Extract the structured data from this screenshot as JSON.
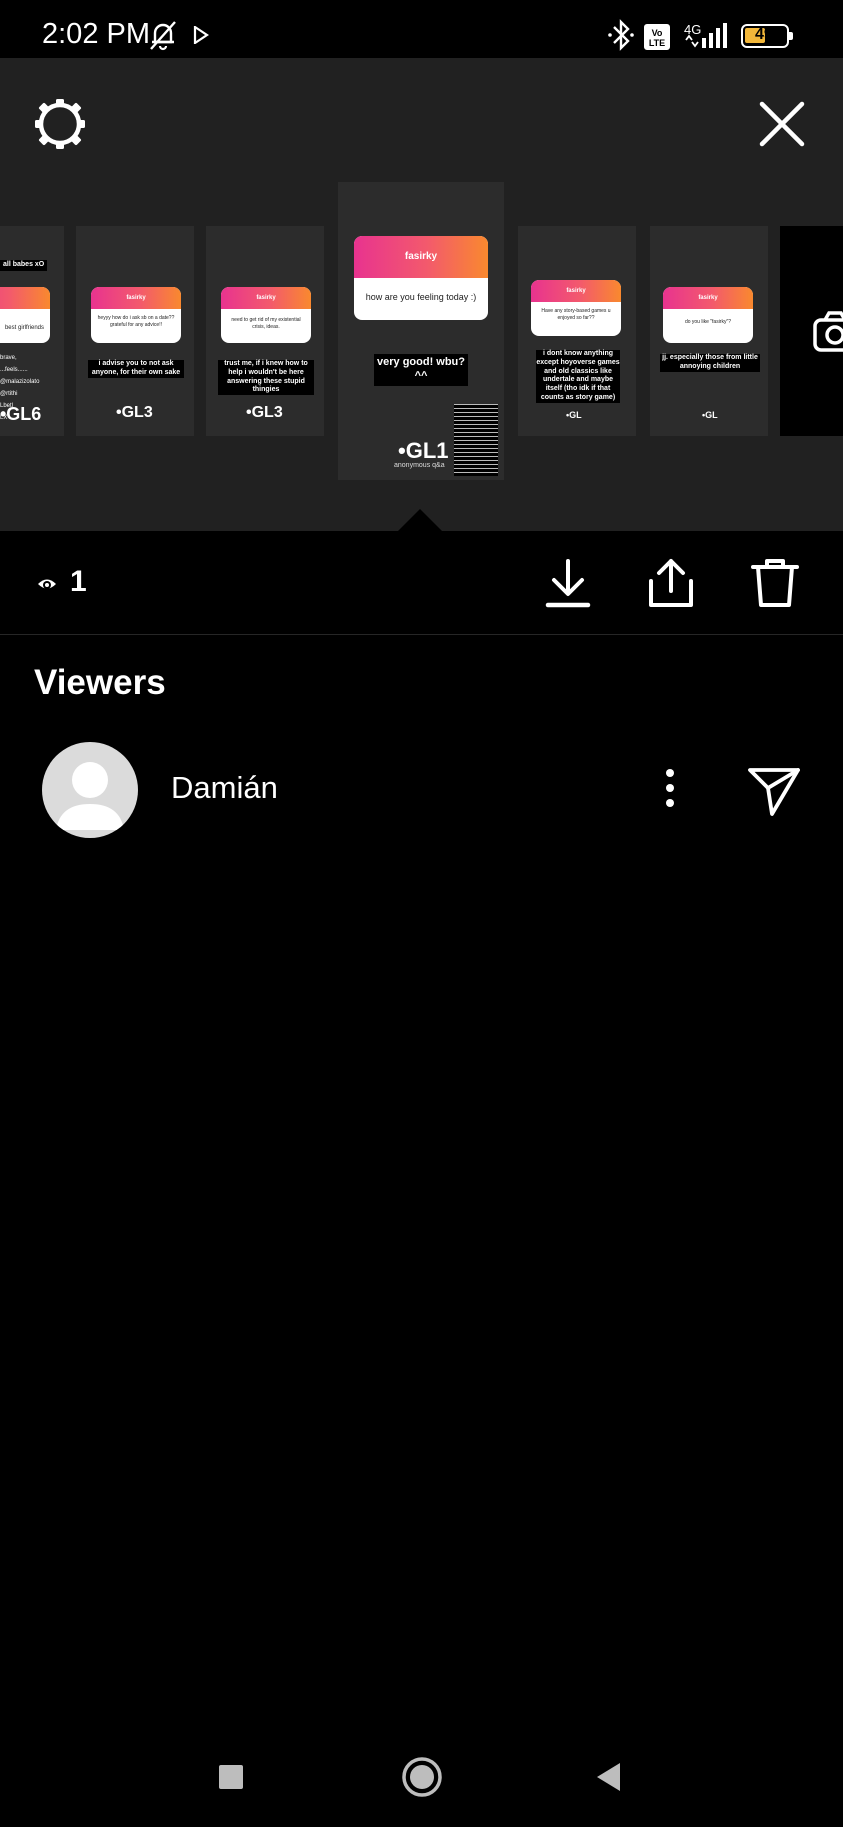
{
  "status_bar": {
    "time": "2:02 PM",
    "volte_label": "Vo\nLTE",
    "network": "4G",
    "battery_level": "49"
  },
  "top_panel": {
    "settings_icon": "settings-gear-icon",
    "close_icon": "close-x-icon",
    "thumbnails": [
      {
        "caption": "all babes xO"
      },
      {
        "header": "fasirky",
        "question": "heyyy how do i ask sb on a date?? grateful for any advice!!",
        "caption": "i advise you to not ask anyone, for their own sake",
        "mark": "3"
      },
      {
        "header": "fasirky",
        "question": "need to get rid of my existential crisis, ideas.",
        "caption": "trust me, if i knew how to help i wouldn't be here answering these stupid thingies",
        "mark": "3"
      },
      {
        "header": "fasirky",
        "question": "how are you feeling today :)",
        "caption": "very good! wbu? ^^",
        "mark": "1",
        "subtext": "anonymous q&a"
      },
      {
        "header": "fasirky",
        "question": "Have any story-based games u enjoyed so far??",
        "caption": "i dont know anything except hoyoverse games and old classics like undertale and maybe itself (tho idk if that counts as story game)"
      },
      {
        "header": "fasirky",
        "question": "do you like \"fasirky\"?",
        "caption": "jj. especially those from little annoying children"
      }
    ]
  },
  "action_bar": {
    "view_count": "1",
    "download_icon": "download-icon",
    "share_icon": "share-icon",
    "delete_icon": "trash-icon"
  },
  "viewers": {
    "title": "Viewers",
    "items": [
      {
        "name": "Damián"
      }
    ]
  }
}
